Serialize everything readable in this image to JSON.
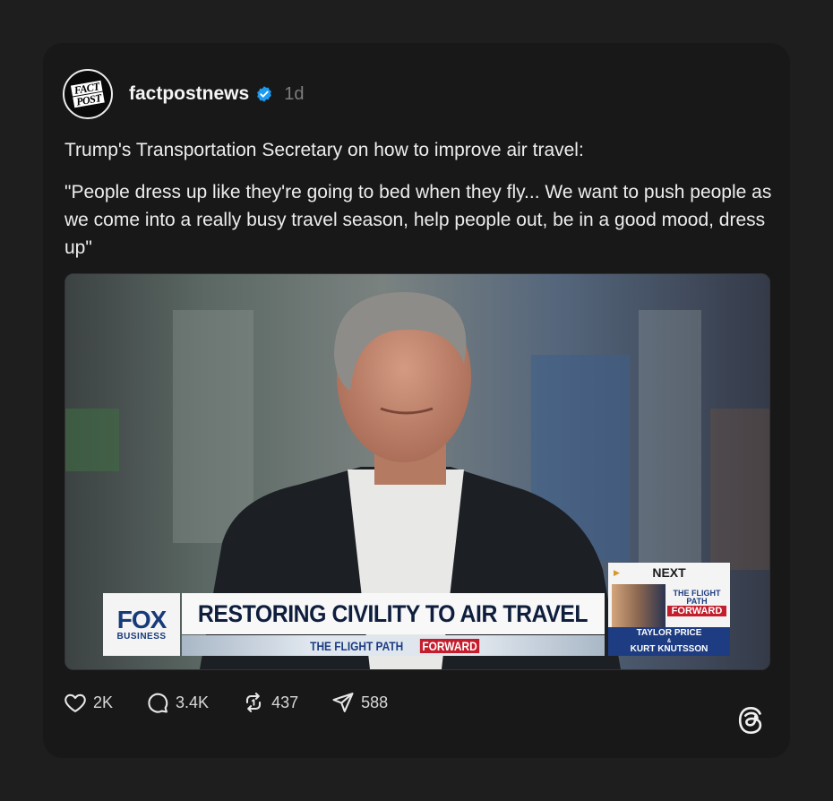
{
  "post": {
    "username": "factpostnews",
    "verified": true,
    "timestamp": "1d",
    "avatar": {
      "line1": "FACT",
      "line2": "POST"
    },
    "text_line1": "Trump's Transportation Secretary on how to improve air travel:",
    "text_line2": "\"People dress up like they're going to bed when they fly... We want to push people as we come into a really busy travel season, help people out, be in a good mood, dress up\""
  },
  "media": {
    "network": "FOX",
    "network_sub": "BUSINESS",
    "headline": "RESTORING CIVILITY TO AIR TRAVEL",
    "show_prefix": "THE FLIGHT PATH",
    "show_suffix": "FORWARD",
    "next_label": "NEXT",
    "next_show_title": "THE FLIGHT PATH",
    "next_show_suffix": "FORWARD",
    "next_name1": "TAYLOR PRICE",
    "next_amp": "&",
    "next_name2": "KURT KNUTSSON"
  },
  "actions": {
    "likes": "2K",
    "replies": "3.4K",
    "reposts": "437",
    "shares": "588"
  },
  "icons": {
    "like": "heart-icon",
    "reply": "comment-icon",
    "repost": "repost-icon",
    "share": "send-icon",
    "brand": "threads-logo-icon",
    "verified": "verified-badge-icon"
  },
  "colors": {
    "page_bg": "#1e1e1e",
    "card_bg": "#181818",
    "verified": "#1d9bf0",
    "fox_blue": "#173a7a",
    "fox_red": "#c41d2b"
  }
}
